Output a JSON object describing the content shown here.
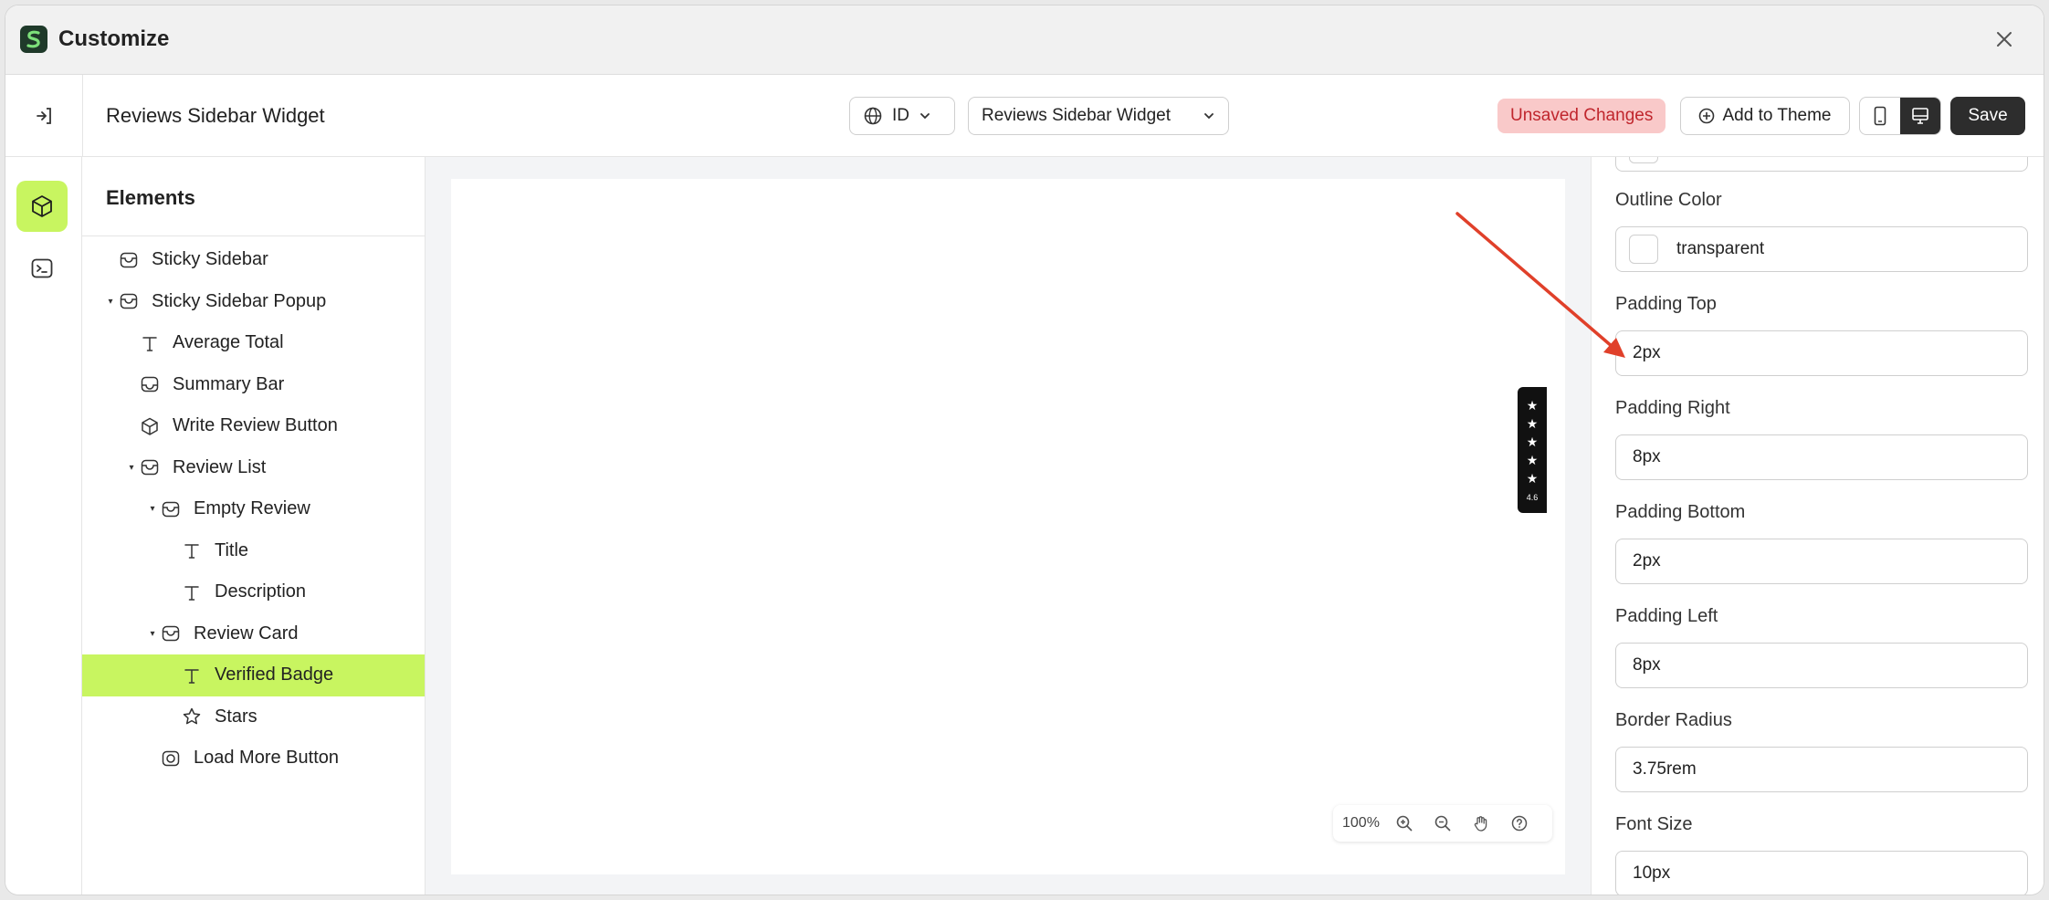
{
  "window": {
    "title": "Customize"
  },
  "toolbar": {
    "page_name": "Reviews Sidebar Widget",
    "language": "ID",
    "page_select": "Reviews Sidebar Widget",
    "status": "Unsaved Changes",
    "add_to_theme_label": "Add to Theme",
    "save_label": "Save"
  },
  "elements": {
    "title": "Elements",
    "items": [
      {
        "label": "Sticky Sidebar",
        "depth": 0,
        "icon": "section-icon",
        "caret": false
      },
      {
        "label": "Sticky Sidebar Popup",
        "depth": 0,
        "icon": "section-icon",
        "caret": true
      },
      {
        "label": "Average Total",
        "depth": 1,
        "icon": "text-icon",
        "caret": false
      },
      {
        "label": "Summary Bar",
        "depth": 1,
        "icon": "inbox-icon",
        "caret": false
      },
      {
        "label": "Write Review Button",
        "depth": 1,
        "icon": "cube-icon",
        "caret": false
      },
      {
        "label": "Review List",
        "depth": 1,
        "icon": "section-icon",
        "caret": true
      },
      {
        "label": "Empty Review",
        "depth": 2,
        "icon": "section-icon",
        "caret": true
      },
      {
        "label": "Title",
        "depth": 3,
        "icon": "text-icon",
        "caret": false
      },
      {
        "label": "Description",
        "depth": 3,
        "icon": "text-icon",
        "caret": false
      },
      {
        "label": "Review Card",
        "depth": 2,
        "icon": "section-icon",
        "caret": true
      },
      {
        "label": "Verified Badge",
        "depth": 3,
        "icon": "text-icon",
        "caret": false,
        "selected": true
      },
      {
        "label": "Stars",
        "depth": 3,
        "icon": "star-icon",
        "caret": false
      },
      {
        "label": "Load More Button",
        "depth": 2,
        "icon": "button-icon",
        "caret": false
      }
    ]
  },
  "canvas": {
    "zoom": "100%",
    "widget_rating": "4.6"
  },
  "properties": {
    "partial_value": "#fff",
    "outline_color": {
      "label": "Outline Color",
      "value": "transparent"
    },
    "padding_top": {
      "label": "Padding Top",
      "value": "2px"
    },
    "padding_right": {
      "label": "Padding Right",
      "value": "8px"
    },
    "padding_bottom": {
      "label": "Padding Bottom",
      "value": "2px"
    },
    "padding_left": {
      "label": "Padding Left",
      "value": "8px"
    },
    "border_radius": {
      "label": "Border Radius",
      "value": "3.75rem"
    },
    "font_size": {
      "label": "Font Size",
      "value": "10px"
    }
  },
  "colors": {
    "accent": "#c8f560",
    "unsaved_bg": "#f9c9c9",
    "unsaved_text": "#c0262d",
    "dark": "#2d2d2d",
    "annotation_arrow": "#e0402a"
  }
}
